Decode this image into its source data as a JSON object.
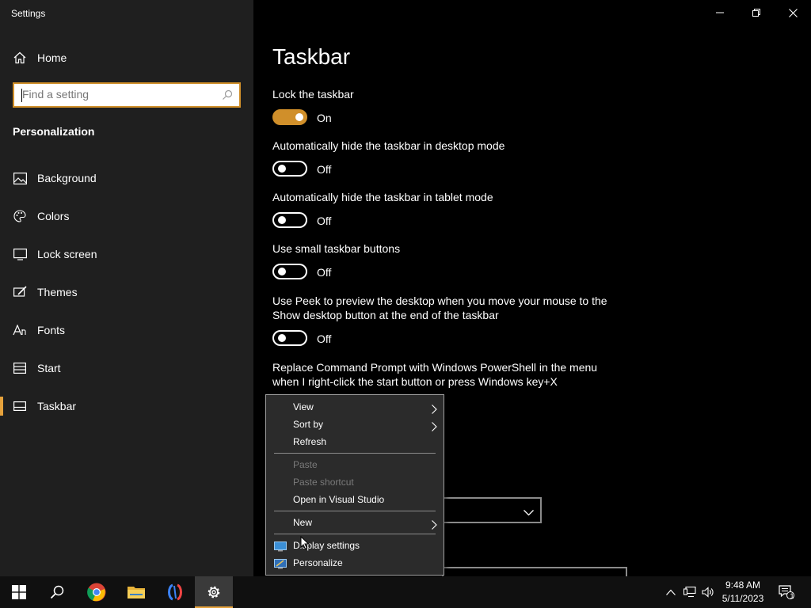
{
  "window": {
    "title": "Settings",
    "controls": {
      "minimize": "minimize",
      "restore": "restore",
      "close": "close"
    }
  },
  "sidebar": {
    "home_label": "Home",
    "search_placeholder": "Find a setting",
    "section_heading": "Personalization",
    "items": [
      {
        "label": "Background",
        "icon": "background-image-icon"
      },
      {
        "label": "Colors",
        "icon": "palette-icon"
      },
      {
        "label": "Lock screen",
        "icon": "lock-screen-icon"
      },
      {
        "label": "Themes",
        "icon": "themes-brush-icon"
      },
      {
        "label": "Fonts",
        "icon": "fonts-icon"
      },
      {
        "label": "Start",
        "icon": "start-menu-icon"
      },
      {
        "label": "Taskbar",
        "icon": "taskbar-icon",
        "active": true
      }
    ]
  },
  "main": {
    "title": "Taskbar",
    "settings": [
      {
        "label": "Lock the taskbar",
        "state": "On",
        "on": true
      },
      {
        "label": "Automatically hide the taskbar in desktop mode",
        "state": "Off",
        "on": false
      },
      {
        "label": "Automatically hide the taskbar in tablet mode",
        "state": "Off",
        "on": false
      },
      {
        "label": "Use small taskbar buttons",
        "state": "Off",
        "on": false
      },
      {
        "label": "Use Peek to preview the desktop when you move your mouse to the Show desktop button at the end of the taskbar",
        "state": "Off",
        "on": false
      },
      {
        "label": "Replace Command Prompt with Windows PowerShell in the menu when I right-click the start button or press Windows key+X"
      }
    ]
  },
  "context_menu": {
    "items": [
      {
        "label": "View",
        "submenu": true
      },
      {
        "label": "Sort by",
        "submenu": true
      },
      {
        "label": "Refresh"
      },
      {
        "label": "Paste",
        "disabled": true
      },
      {
        "label": "Paste shortcut",
        "disabled": true
      },
      {
        "label": "Open in Visual Studio"
      },
      {
        "label": "New",
        "submenu": true
      },
      {
        "label": "Display settings",
        "icon": "display-settings-icon"
      },
      {
        "label": "Personalize",
        "icon": "personalize-icon"
      }
    ]
  },
  "taskbar": {
    "apps": [
      "windows-start-icon",
      "search-icon",
      "chrome-icon",
      "file-explorer-icon",
      "visual-studio-icon",
      "settings-gear-icon"
    ],
    "time": "9:48 AM",
    "date": "5/11/2023",
    "notification_count": "1"
  },
  "colors": {
    "accent": "#d08f2a",
    "sidebar_bg": "#1f1f1f",
    "main_bg": "#000000",
    "menu_bg": "#2b2b2b"
  }
}
